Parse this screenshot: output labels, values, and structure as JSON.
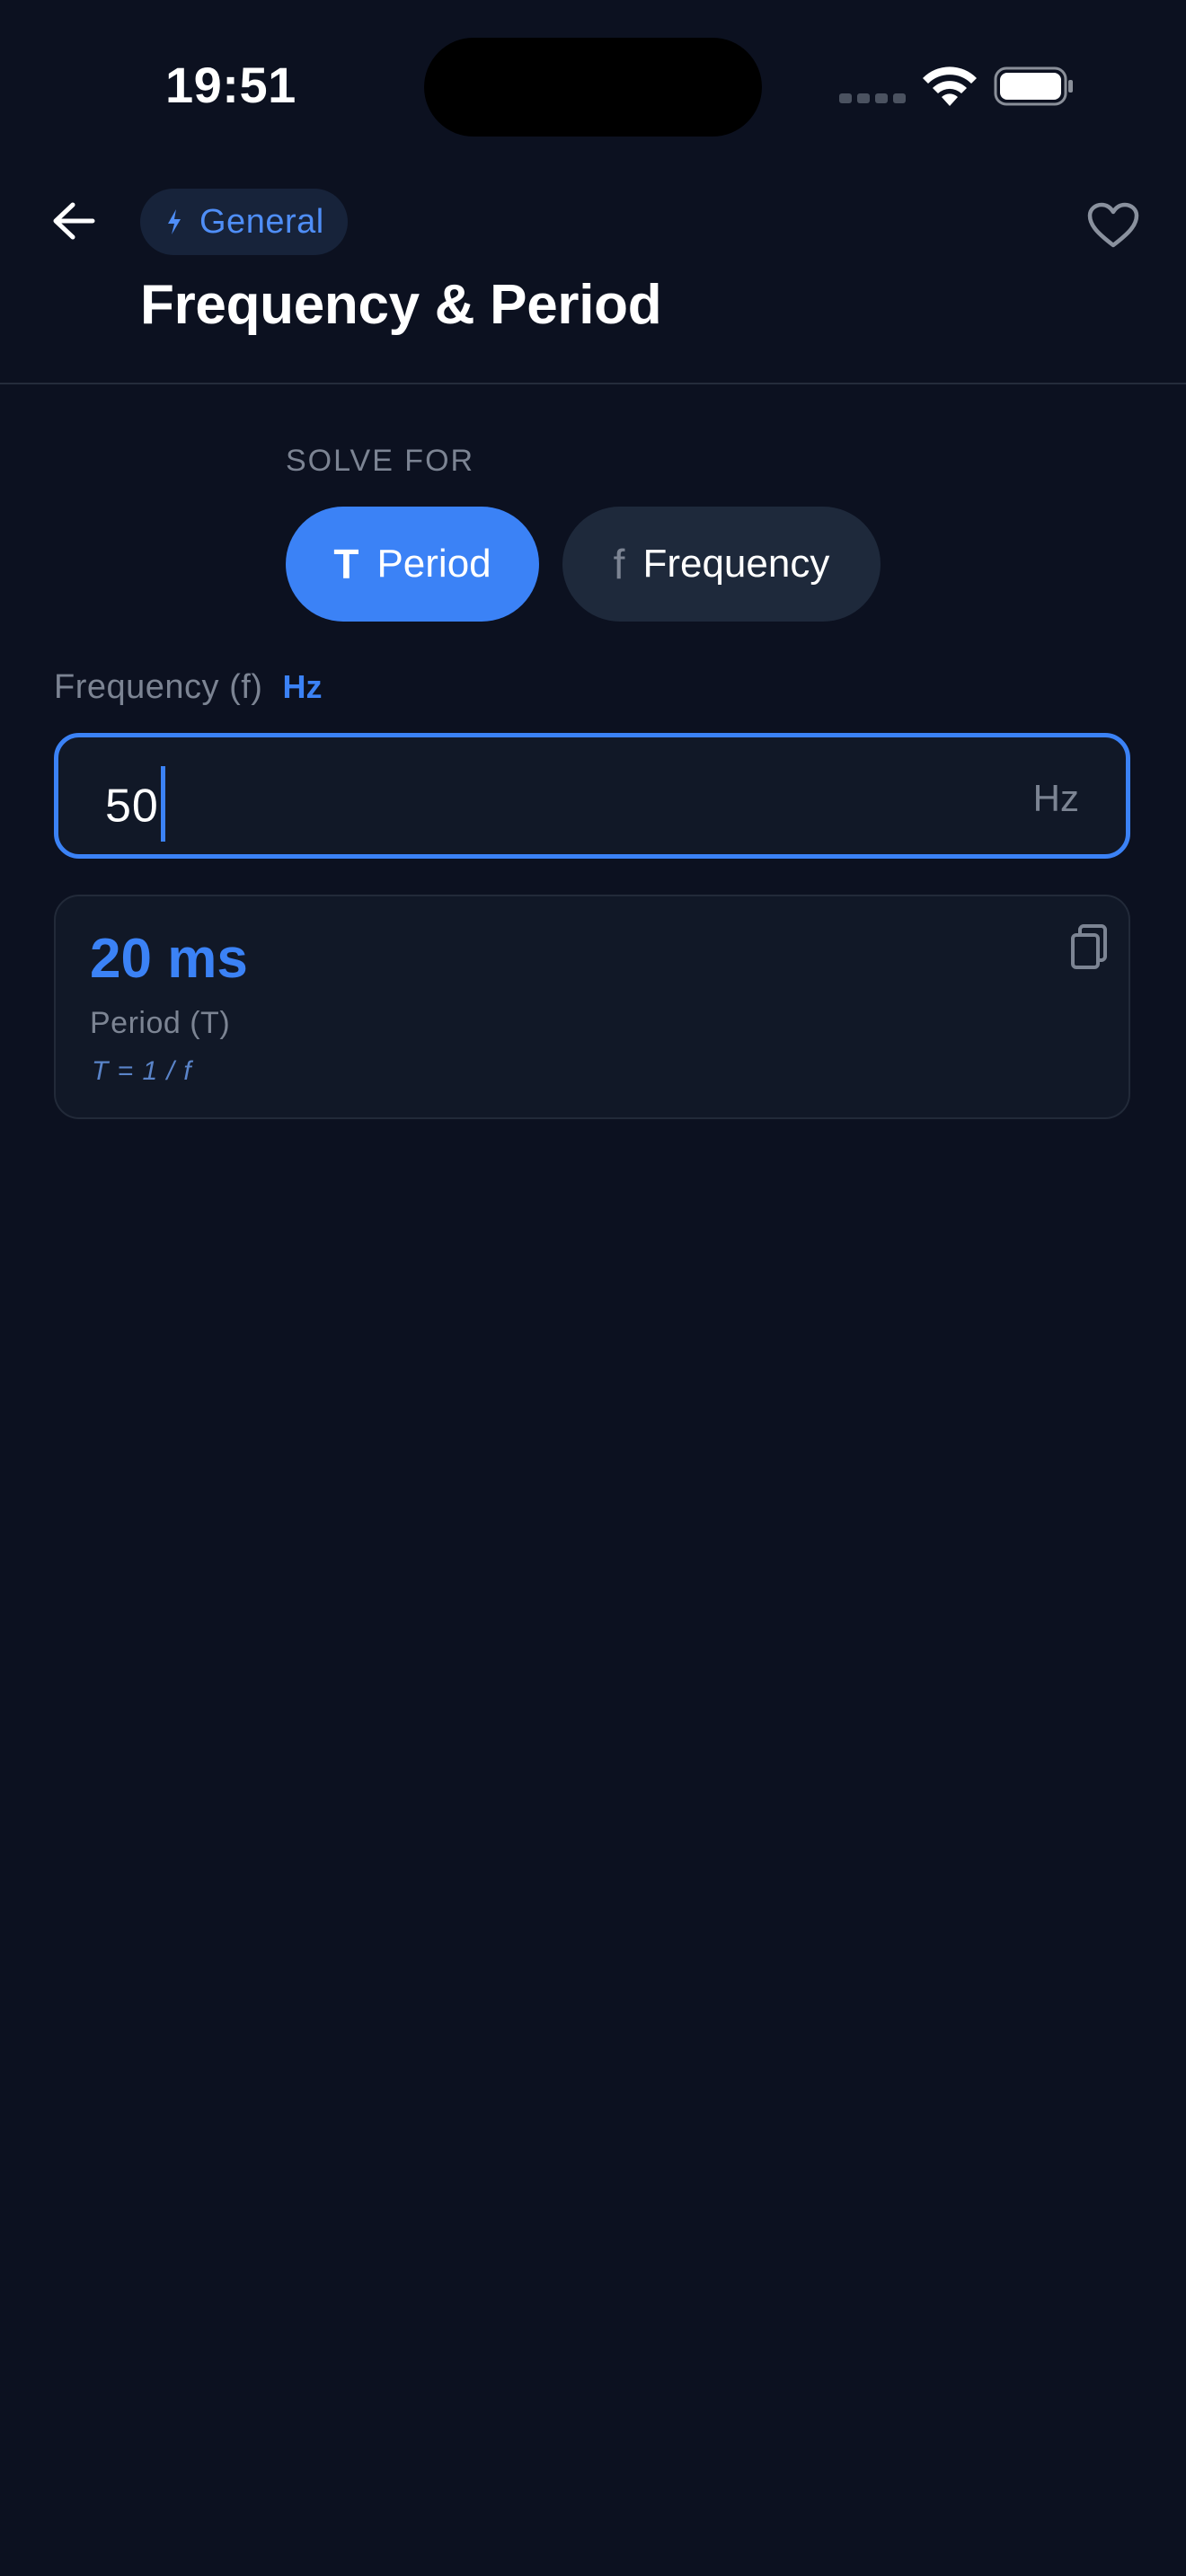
{
  "status_bar": {
    "time": "19:51"
  },
  "header": {
    "category": "General",
    "title": "Frequency & Period",
    "icons": {
      "back": "arrow-left-icon",
      "category": "lightning-icon",
      "favorite": "heart-icon"
    }
  },
  "solve_for": {
    "label": "SOLVE FOR",
    "options": [
      {
        "symbol": "T",
        "label": "Period",
        "selected": true
      },
      {
        "symbol": "f",
        "label": "Frequency",
        "selected": false
      }
    ]
  },
  "input": {
    "label": "Frequency (f)",
    "unit_label": "Hz",
    "value": "50",
    "unit_suffix": "Hz"
  },
  "result": {
    "value": "20 ms",
    "label": "Period (T)",
    "formula": "T = 1 / f",
    "copy_icon": "copy-icon"
  },
  "colors": {
    "background": "#0c1120",
    "accent": "#3b82f6",
    "card": "#111827",
    "muted_text": "#7c8493"
  }
}
